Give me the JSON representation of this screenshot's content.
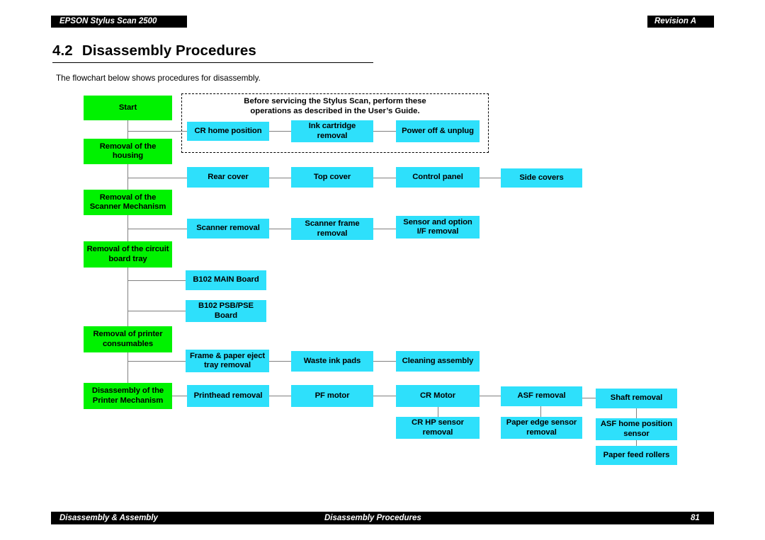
{
  "header": {
    "title": "EPSON Stylus Scan 2500",
    "revision": "Revision A"
  },
  "heading": {
    "number": "4.2",
    "title": "Disassembly Procedures"
  },
  "intro": "The flowchart below shows procedures for disassembly.",
  "note": {
    "line1": "Before servicing the Stylus Scan, perform these",
    "line2": "operations as described in the User’s Guide."
  },
  "colors": {
    "stage": "#00f200",
    "step": "#2ee0fb",
    "connector": "#808080",
    "header_band": "#000000"
  },
  "flowchart": {
    "stages": [
      {
        "id": "start",
        "label": "Start"
      },
      {
        "id": "housing",
        "label": "Removal of the housing"
      },
      {
        "id": "scanner",
        "label": "Removal of the Scanner Mechanism"
      },
      {
        "id": "board-tray",
        "label": "Removal of the circuit board tray"
      },
      {
        "id": "consumables",
        "label": "Removal of printer consumables"
      },
      {
        "id": "printer-mech",
        "label": "Disassembly of the Printer Mechanism"
      }
    ],
    "steps": [
      {
        "id": "cr-home-position",
        "label": "CR home position"
      },
      {
        "id": "ink-cartridge",
        "label": "Ink cartridge removal"
      },
      {
        "id": "power-off",
        "label": "Power off & unplug"
      },
      {
        "id": "rear-cover",
        "label": "Rear cover"
      },
      {
        "id": "top-cover",
        "label": "Top cover"
      },
      {
        "id": "control-panel",
        "label": "Control panel"
      },
      {
        "id": "side-covers",
        "label": "Side covers"
      },
      {
        "id": "scanner-removal",
        "label": "Scanner removal"
      },
      {
        "id": "scanner-frame",
        "label": "Scanner frame removal"
      },
      {
        "id": "sensor-option-if",
        "label": "Sensor and option I/F removal"
      },
      {
        "id": "b102-main",
        "label": "B102 MAIN Board"
      },
      {
        "id": "b102-psb-pse",
        "label": "B102 PSB/PSE Board"
      },
      {
        "id": "frame-paper-eject",
        "label": "Frame & paper eject tray removal"
      },
      {
        "id": "waste-ink-pads",
        "label": "Waste ink pads"
      },
      {
        "id": "cleaning-assembly",
        "label": "Cleaning assembly"
      },
      {
        "id": "printhead-removal",
        "label": "Printhead removal"
      },
      {
        "id": "pf-motor",
        "label": "PF motor"
      },
      {
        "id": "cr-motor",
        "label": "CR Motor"
      },
      {
        "id": "asf-removal",
        "label": "ASF removal"
      },
      {
        "id": "shaft-removal",
        "label": "Shaft removal"
      },
      {
        "id": "cr-hp-sensor",
        "label": "CR HP sensor removal"
      },
      {
        "id": "paper-edge-sensor",
        "label": "Paper edge sensor removal"
      },
      {
        "id": "asf-home-sensor",
        "label": "ASF home position sensor"
      },
      {
        "id": "paper-feed-rollers",
        "label": "Paper feed rollers"
      }
    ]
  },
  "footer": {
    "left": "Disassembly & Assembly",
    "center": "Disassembly Procedures",
    "page": "81"
  }
}
